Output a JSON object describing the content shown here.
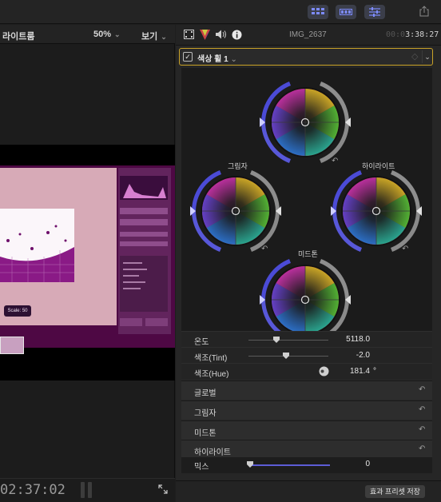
{
  "toolbar": {
    "buttons": [
      "browser-layout-icon",
      "timeline-layout-icon",
      "inspector-adjust-icon",
      "share-icon"
    ],
    "accent": "#5a6cff"
  },
  "viewer": {
    "library_label": "라이트룸",
    "zoom": "50%",
    "view_menu": "보기",
    "overlay_chip": "Scale: 50",
    "timecode": "02:37:02"
  },
  "inspector": {
    "header_icons": [
      "video-film-icon",
      "color-inspector-icon",
      "audio-speaker-icon",
      "info-icon"
    ],
    "clip_name": "IMG_2637",
    "clip_time_dim": "00:0",
    "clip_time": "3:38:27",
    "effect": {
      "name": "색상 휠 1",
      "enabled": true,
      "highlight_color": "#c9a227"
    },
    "wheels": {
      "shadows_label": "그림자",
      "highlights_label": "하이라이트",
      "midtones_label": "미드톤"
    },
    "params": {
      "temperature": {
        "label": "온도",
        "value": "5118.0"
      },
      "tint": {
        "label": "색조(Tint)",
        "value": "-2.0"
      },
      "hue": {
        "label": "색조(Hue)",
        "value": "181.4",
        "unit": "°"
      }
    },
    "sections": [
      "글로벌",
      "그림자",
      "미드톤",
      "하이라이트"
    ],
    "mix": {
      "label": "믹스",
      "value": "0"
    },
    "save_preset_label": "효과 프리셋 저장"
  }
}
